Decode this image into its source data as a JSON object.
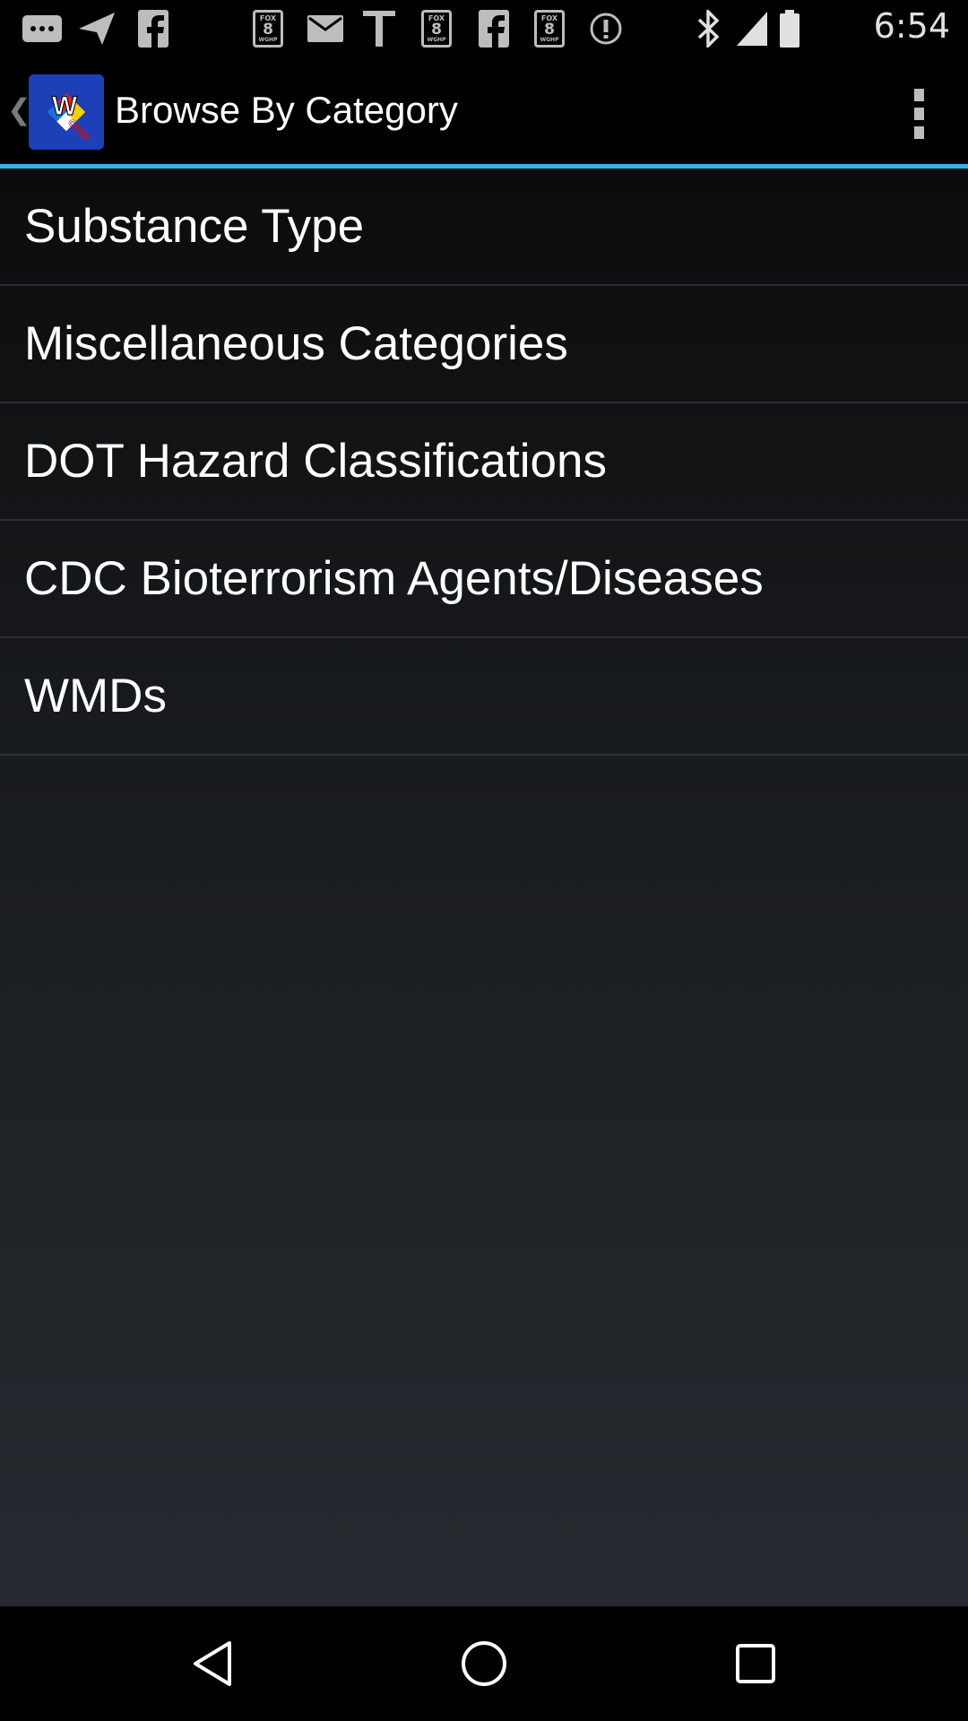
{
  "status_bar": {
    "time": "6:54",
    "icons": [
      "messages-icon",
      "send-icon",
      "facebook-icon",
      "fox8-news-icon",
      "email-icon",
      "text-icon",
      "fox8-news-icon",
      "facebook-icon",
      "fox8-news-icon",
      "info-icon",
      "bluetooth-icon",
      "signal-icon",
      "battery-icon"
    ],
    "fox_badge": {
      "top": "FOX",
      "number": "8",
      "bottom": "WGHP"
    }
  },
  "action_bar": {
    "title": "Browse By Category",
    "logo_letter": "W",
    "logo_text": "©NIH",
    "accent_color": "#33b5e5"
  },
  "categories": [
    {
      "label": "Substance Type"
    },
    {
      "label": "Miscellaneous Categories"
    },
    {
      "label": "DOT Hazard Classifications"
    },
    {
      "label": "CDC Bioterrorism Agents/Diseases"
    },
    {
      "label": "WMDs"
    }
  ],
  "nav_bar": {
    "buttons": [
      "back-icon",
      "home-icon",
      "recents-icon"
    ]
  }
}
